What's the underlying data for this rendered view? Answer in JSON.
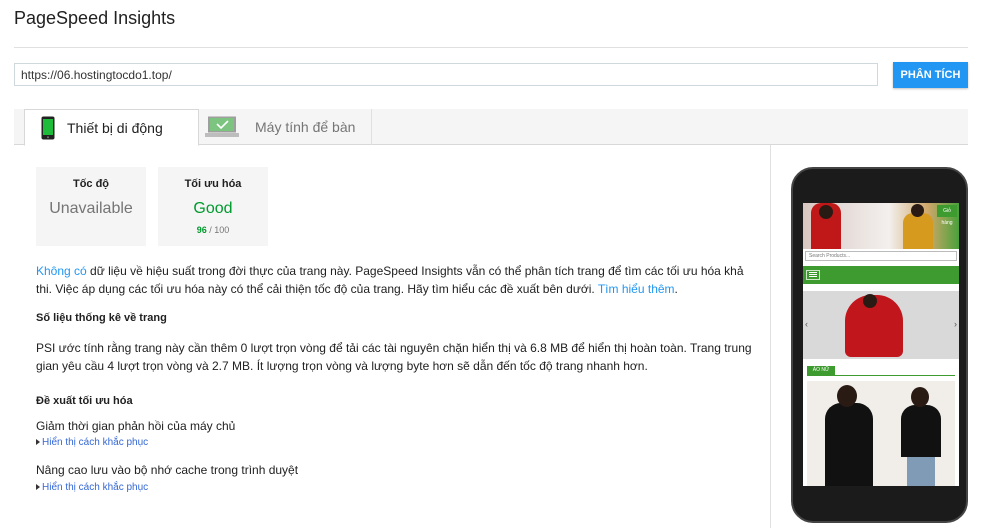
{
  "app": {
    "title": "PageSpeed Insights"
  },
  "form": {
    "url_value": "https://06.hostingtocdo1.top/",
    "analyze_label": "PHÂN TÍCH"
  },
  "tabs": [
    {
      "label": "Thiết bị di động",
      "icon": "mobile-phone-icon",
      "active": true
    },
    {
      "label": "Máy tính để bàn",
      "icon": "desktop-monitor-icon",
      "active": false
    }
  ],
  "scores": {
    "speed": {
      "title": "Tốc độ",
      "value": "Unavailable"
    },
    "optimization": {
      "title": "Tối ưu hóa",
      "value": "Good",
      "score": "96",
      "score_suffix": " / 100"
    }
  },
  "summary": {
    "link1": "Không có",
    "text": " dữ liệu về hiệu suất trong đời thực của trang này. PageSpeed Insights vẫn có thể phân tích trang để tìm các tối ưu hóa khả thi. Việc áp dụng các tối ưu hóa này có thể cải thiện tốc độ của trang. Hãy tìm hiểu các đề xuất bên dưới. ",
    "link2": "Tìm hiểu thêm",
    "end": "."
  },
  "stats": {
    "heading": "Số liệu thống kê về trang",
    "text": "PSI ước tính rằng trang này cần thêm 0 lượt trọn vòng để tải các tài nguyên chặn hiển thị và 6.8 MB để hiển thị hoàn toàn. Trang trung gian yêu cầu 4 lượt trọn vòng và 2.7 MB. Ít lượng trọn vòng và lượng byte hơn sẽ dẫn đến tốc độ trang nhanh hơn."
  },
  "suggestions": {
    "heading": "Đề xuất tối ưu hóa",
    "items": [
      {
        "title": "Giảm thời gian phản hồi của máy chủ",
        "link": "Hiển thị cách khắc phục"
      },
      {
        "title": "Nâng cao lưu vào bộ nhớ cache trong trình duyệt",
        "link": "Hiển thị cách khắc phục"
      }
    ]
  },
  "preview": {
    "search_placeholder": "Search Products...",
    "cart_label": "Giỏ hàng",
    "category_label": "ÁO NỮ",
    "colors": {
      "brand_green": "#3e9b2f",
      "accent_blue": "#2196f3",
      "good_green": "#009a2e"
    }
  }
}
